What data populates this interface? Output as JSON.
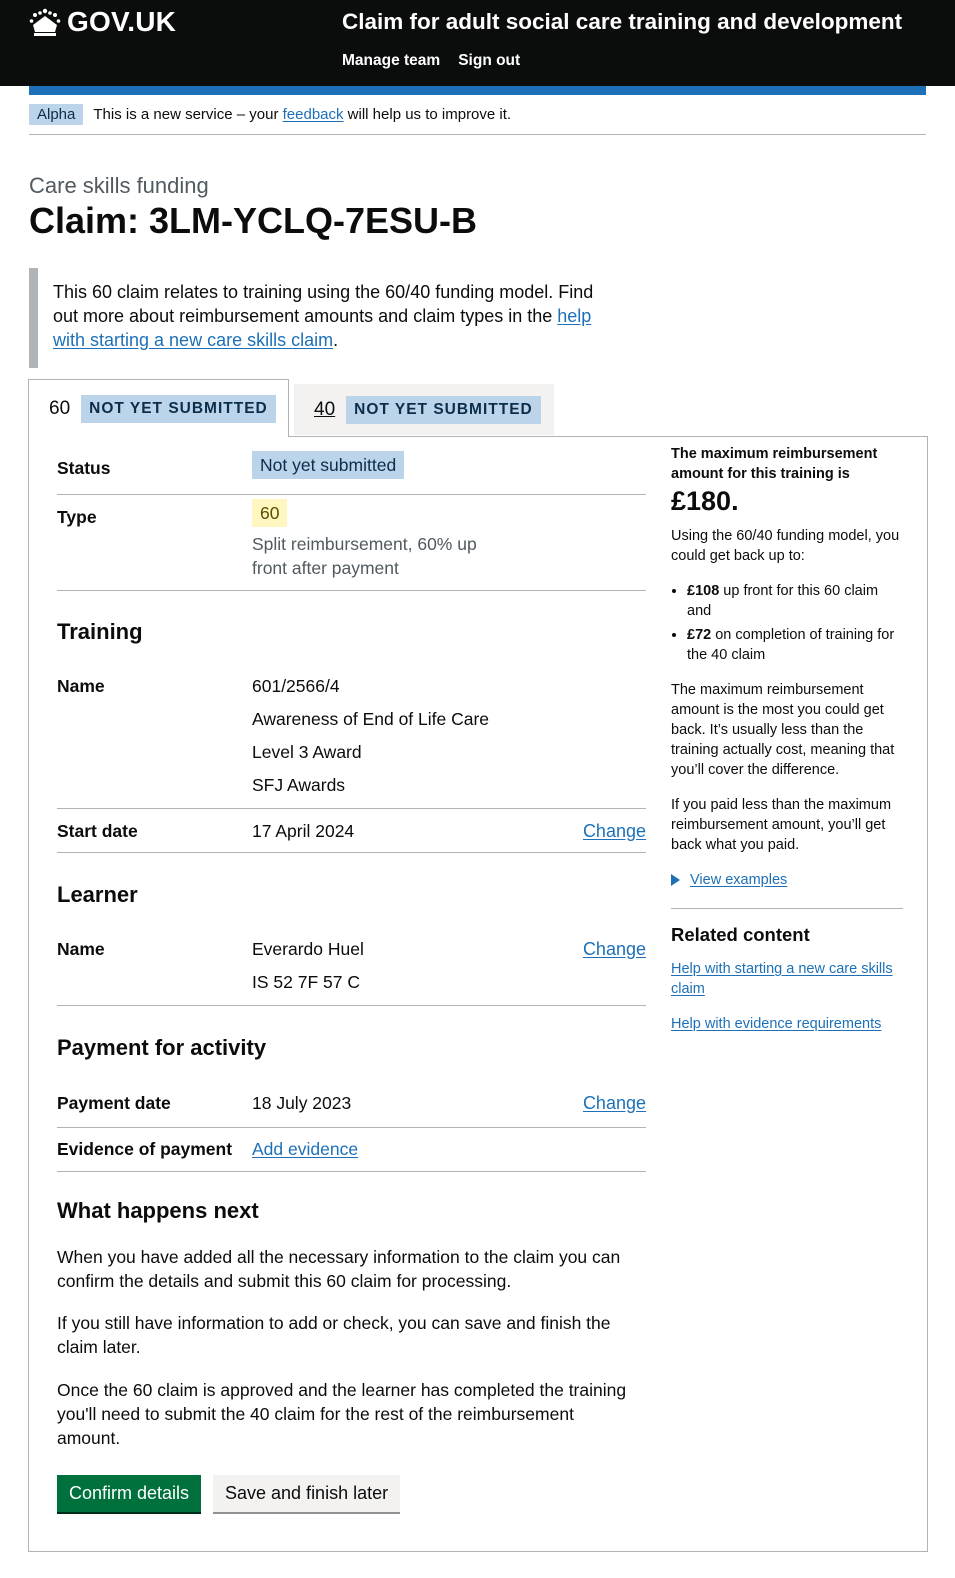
{
  "header": {
    "logo_text": "GOV.UK",
    "service_name": "Claim for adult social care training and development",
    "nav": [
      "Manage team",
      "Sign out"
    ]
  },
  "phase_banner": {
    "tag": "Alpha",
    "text_before": "This is a new service – your ",
    "link": "feedback",
    "text_after": " will help us to improve it."
  },
  "page": {
    "caption": "Care skills funding",
    "title": "Claim: 3LM-YCLQ-7ESU-B"
  },
  "inset": {
    "text": "This 60 claim relates to training using the 60/40 funding model. Find out more about reimbursement amounts and claim types in the ",
    "link": "help with starting a new care skills claim",
    "end": "."
  },
  "tabs": [
    {
      "label": "60",
      "tag": "Not yet submitted",
      "selected": true
    },
    {
      "label": "40",
      "tag": "Not yet submitted",
      "selected": false
    }
  ],
  "summary": {
    "status_key": "Status",
    "status_value": "Not yet submitted",
    "type_key": "Type",
    "type_value": "60",
    "type_hint": "Split reimbursement, 60% up front after payment",
    "training_heading": "Training",
    "training_name_key": "Name",
    "training_lines": [
      "601/2566/4",
      "Awareness of End of Life Care",
      "Level 3 Award",
      "SFJ Awards"
    ],
    "start_date_key": "Start date",
    "start_date_value": "17 April 2024",
    "change": "Change",
    "learner_heading": "Learner",
    "learner_name_key": "Name",
    "learner_name": "Everardo Huel",
    "learner_ni": "IS 52 7F 57 C",
    "payment_heading": "Payment for activity",
    "payment_date_key": "Payment date",
    "payment_date_value": "18 July 2023",
    "evidence_key": "Evidence of payment",
    "evidence_link": "Add evidence"
  },
  "next": {
    "heading": "What happens next",
    "p1": "When you have added all the necessary information to the claim you can confirm the details and submit this 60 claim for processing.",
    "p2": "If you still have information to add or check, you can save and finish the claim later.",
    "p3": "Once the 60 claim is approved and the learner has completed the training you'll need to submit the 40 claim for the rest of the reimbursement amount.",
    "primary_button": "Confirm details",
    "secondary_button": "Save and finish later"
  },
  "sidebar": {
    "max_intro": "The maximum reimbursement amount for this training is",
    "max_amount": "£180.",
    "model_text": "Using the 60/40 funding model, you could get back up to:",
    "bullet1_amount": "£108",
    "bullet1_text": " up front for this 60 claim and",
    "bullet2_amount": "£72",
    "bullet2_text": " on completion of training for the 40 claim",
    "p_max": "The maximum reimbursement amount is the most you could get back. It’s usually less than the training actually cost, meaning that you’ll cover the difference.",
    "p_less": "If you paid less than the maximum reimbursement amount, you’ll get back what you paid.",
    "details": "View examples",
    "related_heading": "Related content",
    "related_links": [
      "Help with starting a new care skills claim",
      "Help with evidence requirements"
    ]
  },
  "colors": {
    "header": "#0b0c0c",
    "blue": "#1d70b8",
    "green_button": "#00703c",
    "blue_tag": "#bbd4ea",
    "yellow_tag": "#fff7bf"
  }
}
